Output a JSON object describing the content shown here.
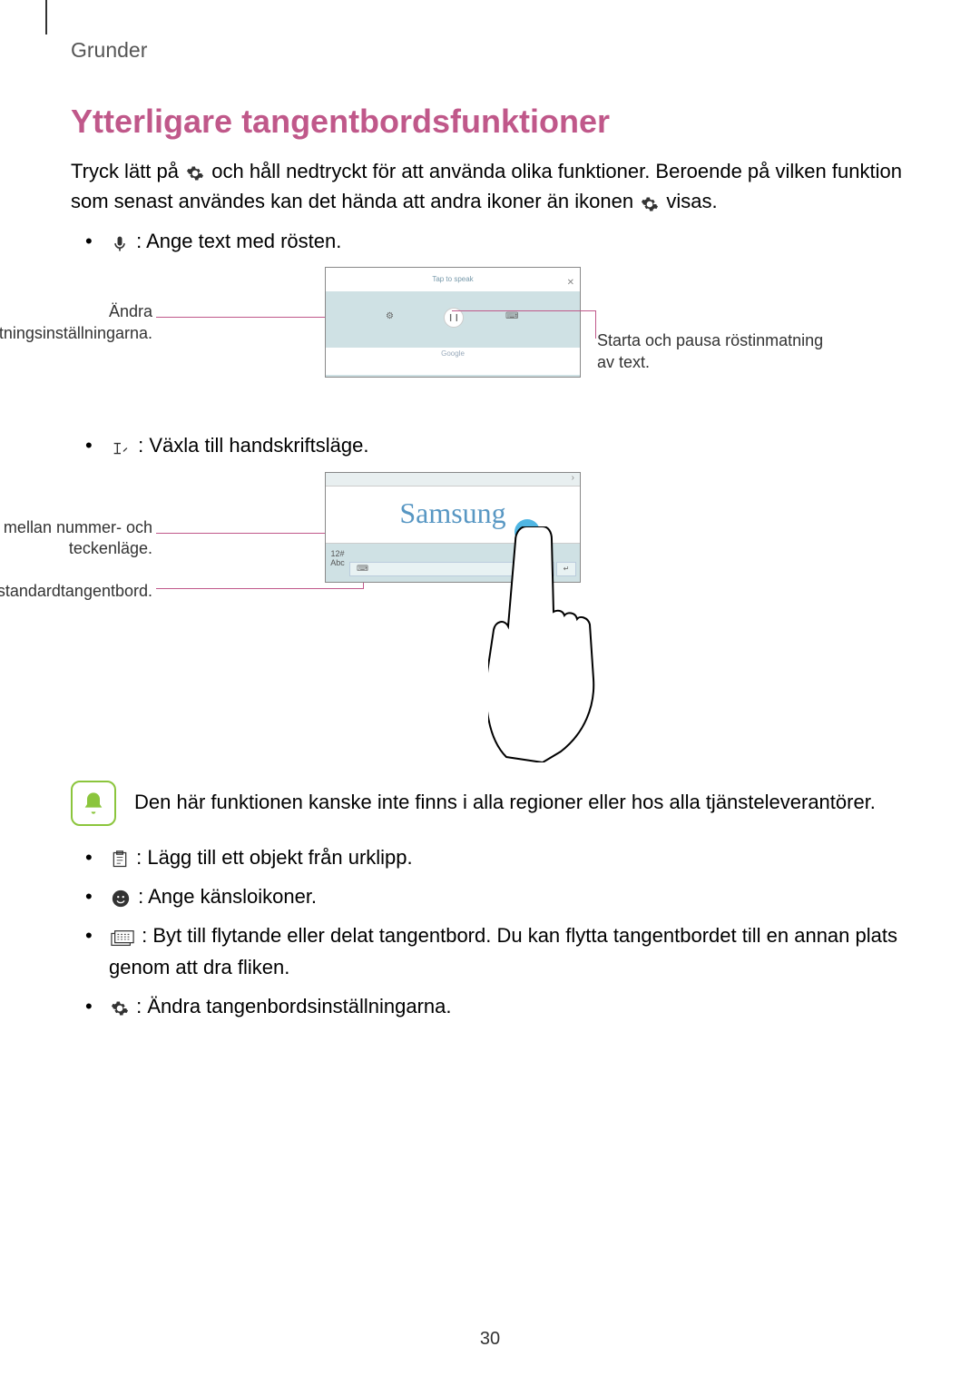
{
  "header": "Grunder",
  "title": "Ytterligare tangentbordsfunktioner",
  "intro_part1": "Tryck lätt på ",
  "intro_part2": " och håll nedtryckt för att använda olika funktioner. Beroende på vilken funktion som senast användes kan det hända att andra ikoner än ikonen ",
  "intro_part3": " visas.",
  "bullet_voice": " : Ange text med rösten.",
  "fig1": {
    "tap_to_speak": "Tap to speak",
    "google": "Google",
    "callout_left": "Ändra röstinmatningsinställningarna.",
    "callout_right": "Starta och pausa röstinmatning av text."
  },
  "bullet_handwrite": " : Växla till handskriftsläge.",
  "fig2": {
    "handwriting_text": "Samsung",
    "callout_left_a": "Växla mellan nummer- och teckenläge.",
    "callout_left_b": "Byt till standardtangentbord."
  },
  "note_text": "Den här funktionen kanske inte finns i alla regioner eller hos alla tjänsteleverantörer.",
  "bullet_clip": " : Lägg till ett objekt från urklipp.",
  "bullet_emoji": " : Ange känsloikoner.",
  "bullet_float": " : Byt till flytande eller delat tangentbord. Du kan flytta tangentbordet till en annan plats genom att dra fliken.",
  "bullet_settings": " : Ändra tangenbordsinställningarna.",
  "page_number": "30"
}
